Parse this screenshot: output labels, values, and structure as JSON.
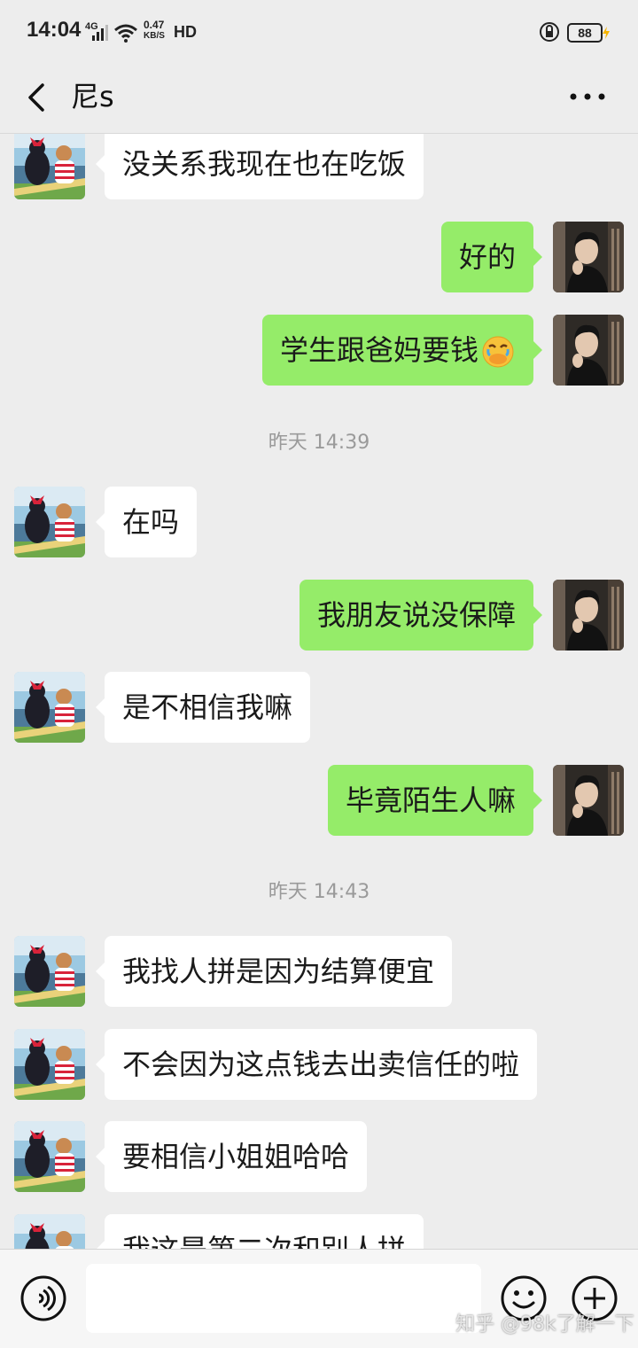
{
  "status_bar": {
    "time": "14:04",
    "network": "4G",
    "speed_value": "0.47",
    "speed_unit": "KB/S",
    "hd": "HD",
    "battery": "88"
  },
  "header": {
    "title": "尼s"
  },
  "messages": [
    {
      "side": "left",
      "text": "没关系我现在也在吃饭"
    },
    {
      "side": "right",
      "text": "好的"
    },
    {
      "side": "right",
      "text": "学生跟爸妈要钱",
      "emoji": "face-with-hand-over-mouth-emoji"
    },
    {
      "timestamp": "昨天 14:39"
    },
    {
      "side": "left",
      "text": "在吗"
    },
    {
      "side": "right",
      "text": "我朋友说没保障"
    },
    {
      "side": "left",
      "text": "是不相信我嘛"
    },
    {
      "side": "right",
      "text": "毕竟陌生人嘛"
    },
    {
      "timestamp": "昨天 14:43"
    },
    {
      "side": "left",
      "text": "我找人拼是因为结算便宜"
    },
    {
      "side": "left",
      "text": "不会因为这点钱去出卖信任的啦"
    },
    {
      "side": "left",
      "text": "要相信小姐姐哈哈"
    },
    {
      "side": "left",
      "text": "我这是第二次和别人拼"
    }
  ],
  "input_bar": {
    "voice_icon": "voice-icon",
    "emoji_icon": "emoji-icon",
    "plus_icon": "plus-icon"
  },
  "watermark": "知乎 @98k了解一下",
  "colors": {
    "background": "#ededed",
    "bubble_self": "#95ec69",
    "bubble_other": "#ffffff",
    "timestamp": "#9a9a9a"
  }
}
